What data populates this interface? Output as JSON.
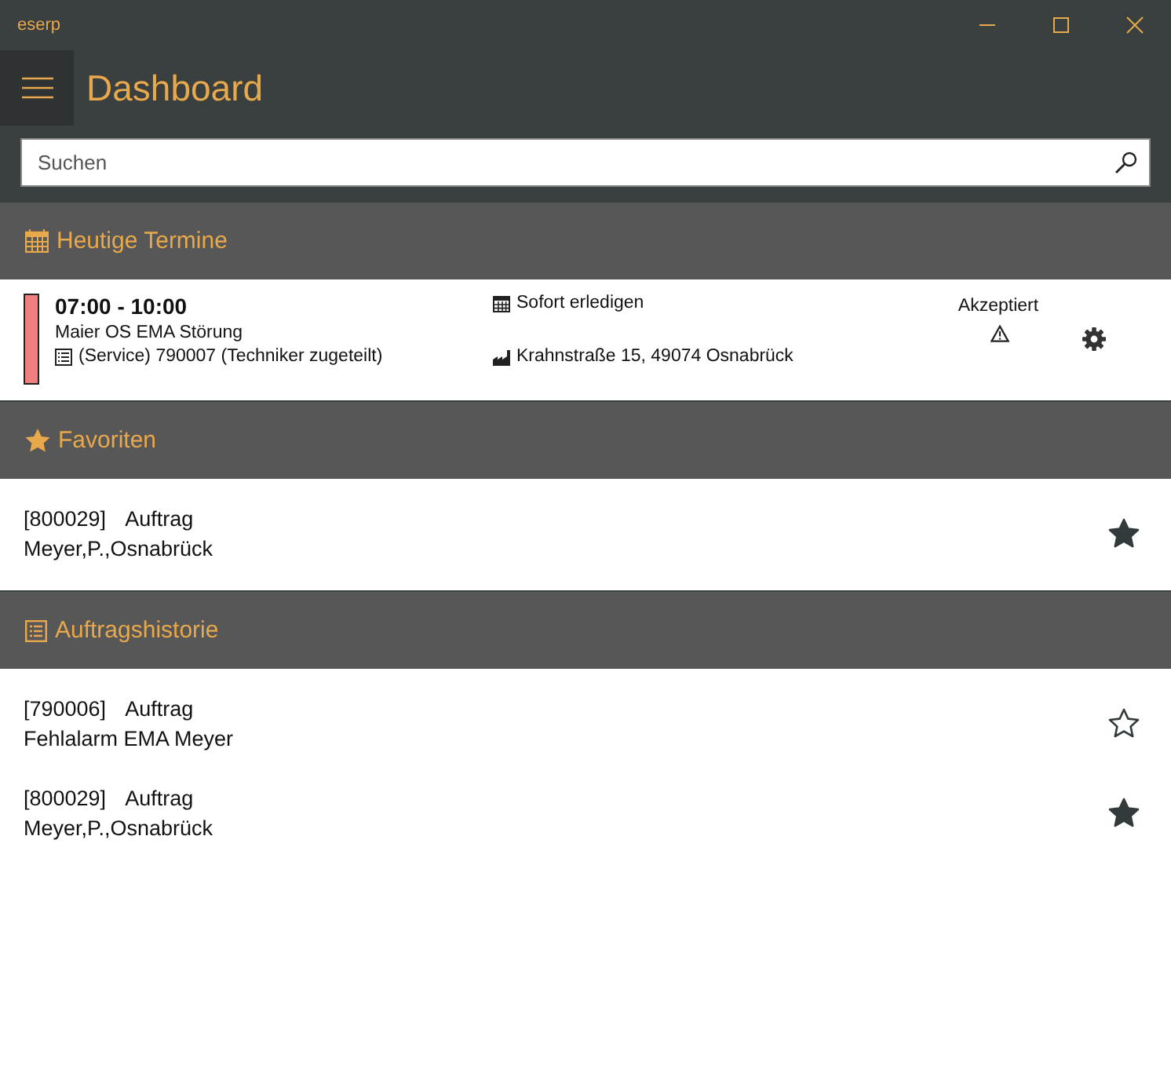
{
  "window": {
    "title": "eserp"
  },
  "page_title": "Dashboard",
  "search": {
    "placeholder": "Suchen"
  },
  "appointments_section": {
    "title": "Heutige Termine",
    "appointments": [
      {
        "time": "07:00 - 10:00",
        "title": "Maier OS EMA Störung",
        "order": "(Service) 790007 (Techniker zugeteilt)",
        "priority": "Sofort erledigen",
        "address": "Krahnstraße 15, 49074 Osnabrück",
        "status": "Akzeptiert",
        "color": "#f08080",
        "warning": true
      }
    ]
  },
  "favorites_section": {
    "title": "Favoriten",
    "items": [
      {
        "number": "[800029]",
        "type": "Auftrag",
        "name": "Meyer,P.,Osnabrück",
        "favorite": true
      }
    ]
  },
  "history_section": {
    "title": "Auftragshistorie",
    "items": [
      {
        "number": "[790006]",
        "type": "Auftrag",
        "name": "Fehlalarm EMA Meyer",
        "favorite": false
      },
      {
        "number": "[800029]",
        "type": "Auftrag",
        "name": "Meyer,P.,Osnabrück",
        "favorite": true
      }
    ]
  }
}
